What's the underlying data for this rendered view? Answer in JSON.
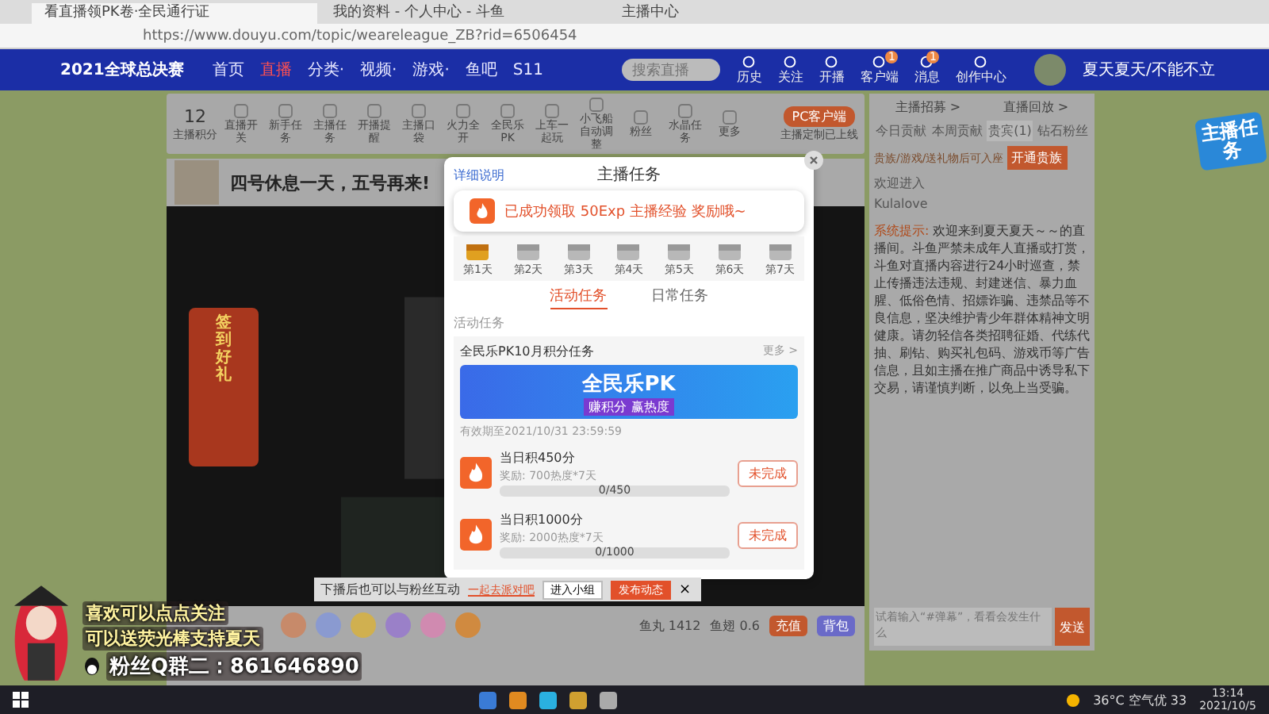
{
  "browser": {
    "tabs": [
      {
        "title": "看直播领PK卷·全民通行证",
        "selected": true
      },
      {
        "title": "我的资料 - 个人中心 - 斗鱼",
        "selected": false
      },
      {
        "title": "主播中心",
        "selected": false
      }
    ],
    "url": "https://www.douyu.com/topic/weareleague_ZB?rid=6506454"
  },
  "header": {
    "logo": "2021全球总决赛",
    "nav": [
      {
        "label": "首页",
        "selected": false
      },
      {
        "label": "直播",
        "selected": true
      },
      {
        "label": "分类·",
        "selected": false
      },
      {
        "label": "视频·",
        "selected": false
      },
      {
        "label": "游戏·",
        "selected": false
      },
      {
        "label": "鱼吧",
        "selected": false
      },
      {
        "label": "S11",
        "selected": false
      }
    ],
    "search": {
      "placeholder": "搜索直播"
    },
    "actions": [
      {
        "label": "历史"
      },
      {
        "label": "关注"
      },
      {
        "label": "开播"
      },
      {
        "label": "客户端",
        "badge": "1"
      },
      {
        "label": "消息",
        "badge": "1"
      },
      {
        "label": "创作中心"
      }
    ],
    "username": "夏天夏天/不能不立"
  },
  "toolbar": {
    "score": "12",
    "score_label": "主播积分",
    "items": [
      "直播开关",
      "新手任务",
      "主播任务",
      "开播提醒",
      "主播口袋",
      "火力全开",
      "全民乐PK",
      "上车一起玩",
      "小飞船自动调整",
      "粉丝",
      "水晶任务",
      "更多"
    ],
    "client_button": "PC客户端",
    "client_note": "主播定制已上线"
  },
  "room": {
    "title": "四号休息一天，五号再来!"
  },
  "promo": {
    "title": "签到好礼"
  },
  "gift_bar": {
    "readings": [
      "鱼丸 1412",
      "鱼翅 0.6"
    ],
    "buttons": [
      "充值",
      "背包"
    ]
  },
  "modal": {
    "help_link": "详细说明",
    "title": "主播任务",
    "toast": "已成功领取 50Exp 主播经验 奖励哦~",
    "days": [
      {
        "label": "第1天",
        "claimed": true
      },
      {
        "label": "第2天",
        "claimed": false
      },
      {
        "label": "第3天",
        "claimed": false
      },
      {
        "label": "第4天",
        "claimed": false
      },
      {
        "label": "第5天",
        "claimed": false
      },
      {
        "label": "第6天",
        "claimed": false
      },
      {
        "label": "第7天",
        "claimed": false
      }
    ],
    "tabs": [
      {
        "label": "活动任务",
        "selected": true
      },
      {
        "label": "日常任务",
        "selected": false
      }
    ],
    "section": "活动任务",
    "card_title": "全民乐PK10月积分任务",
    "more": "更多 >",
    "banner": {
      "title": "全民乐PK",
      "subtitle": "赚积分 赢热度"
    },
    "validity": "有效期至2021/10/31 23:59:59",
    "tasks": [
      {
        "title": "当日积450分",
        "reward": "奖励: 700热度*7天",
        "progress": "0/450",
        "level": 0,
        "status": "未完成"
      },
      {
        "title": "当日积1000分",
        "reward": "奖励: 2000热度*7天",
        "progress": "0/1000",
        "level": 0,
        "status": "未完成"
      }
    ]
  },
  "notice": {
    "text": "下播后也可以与粉丝互动",
    "link": "一起去派对吧",
    "buttons": [
      "进入小组",
      "发布动态"
    ],
    "close": "×"
  },
  "chat": {
    "links": [
      "主播招募 >",
      "直播回放 >"
    ],
    "tabs": [
      {
        "label": "今日贡献",
        "selected": false
      },
      {
        "label": "本周贡献",
        "selected": false
      },
      {
        "label": "贵宾(1)",
        "selected": true
      },
      {
        "label": "钻石粉丝",
        "selected": false
      }
    ],
    "seat_note": "贵族/游戏/送礼物后可入座",
    "open_button": "开通贵族",
    "welcome": "欢迎进入",
    "member": "Kulalove",
    "system_label": "系统提示:",
    "system_text": "欢迎来到夏天夏天～～的直播间。斗鱼严禁未成年人直播或打赏，斗鱼对直播内容进行24小时巡查，禁止传播违法违规、封建迷信、暴力血腥、低俗色情、招嫖诈骗、违禁品等不良信息，坚决维护青少年群体精神文明健康。请勿轻信各类招聘征婚、代练代抽、刷钻、购买礼包码、游戏币等广告信息，且如主播在推广商品中诱导私下交易，请谨慎判断，以免上当受骗。",
    "input_placeholder": "试着输入“#弹幕”，看看会发生什么",
    "send": "发送"
  },
  "side_badge": "主播任务",
  "overlay": {
    "lines": [
      "喜欢可以点点关注",
      "可以送荧光棒支持夏天",
      "粉丝Q群二：861646890"
    ]
  },
  "taskbar": {
    "weather": "36°C 空气优 33",
    "time": "13:14",
    "date": "2021/10/5"
  }
}
